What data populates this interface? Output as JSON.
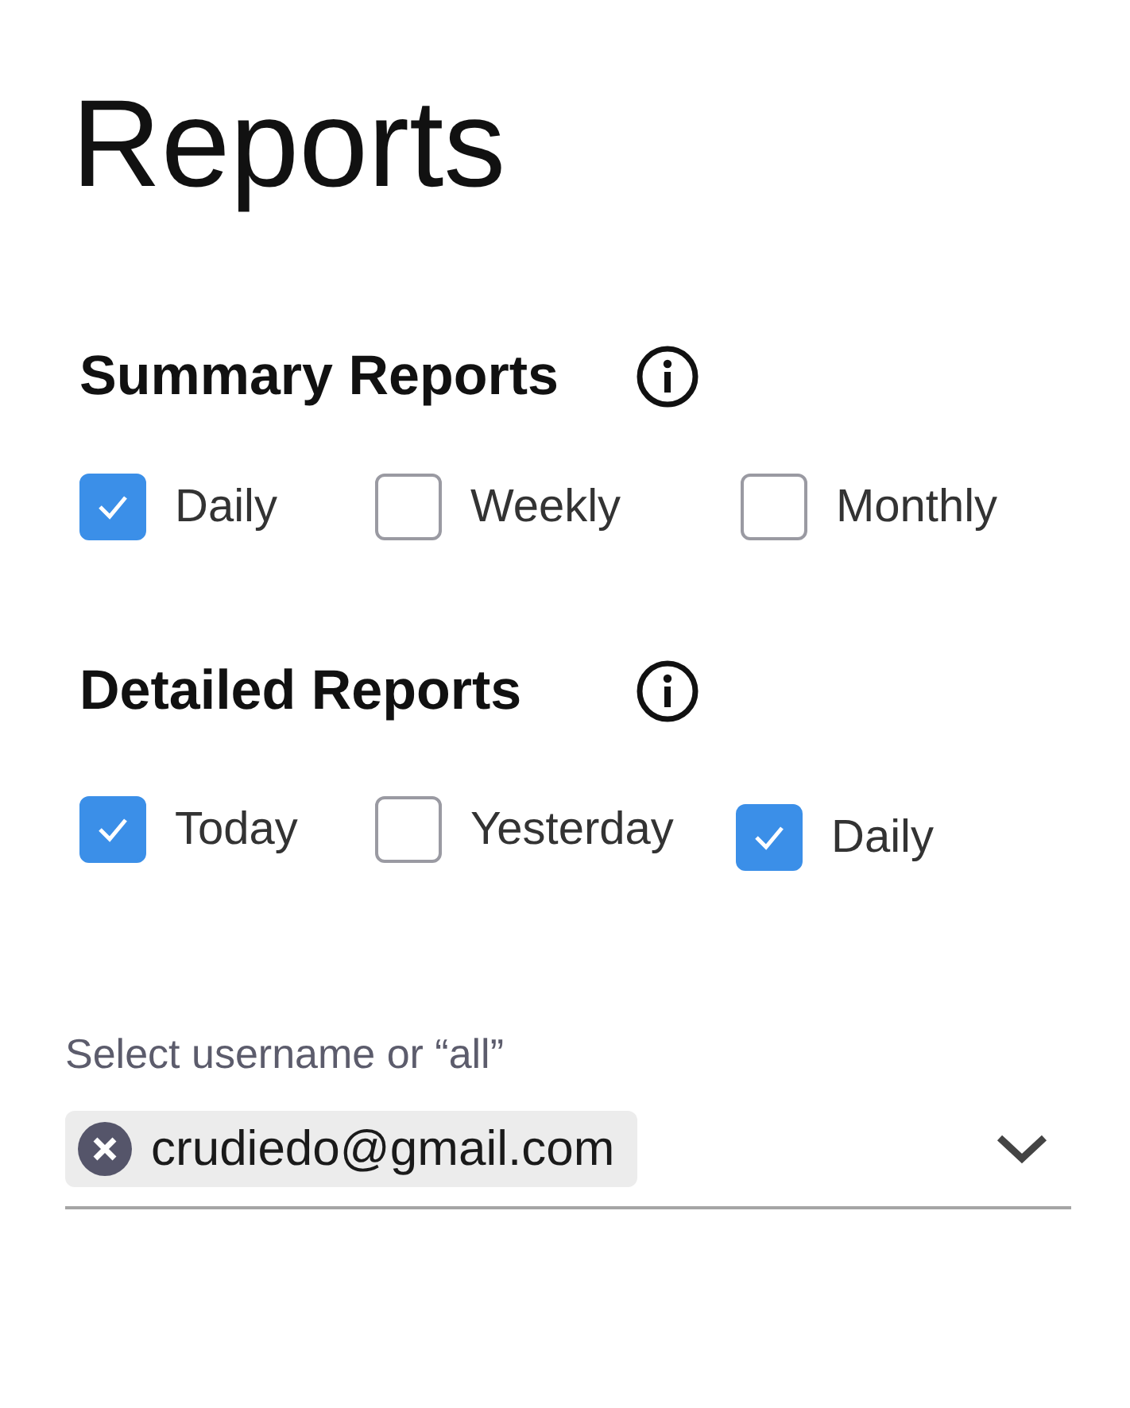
{
  "title": "Reports",
  "sections": [
    {
      "heading": "Summary Reports",
      "options": [
        {
          "label": "Daily",
          "checked": true
        },
        {
          "label": "Weekly",
          "checked": false
        },
        {
          "label": "Monthly",
          "checked": false
        }
      ]
    },
    {
      "heading": "Detailed Reports",
      "options": [
        {
          "label": "Today",
          "checked": true
        },
        {
          "label": "Yesterday",
          "checked": false
        },
        {
          "label": "Daily",
          "checked": true
        }
      ]
    }
  ],
  "user_select": {
    "label": "Select username or “all”",
    "chips": [
      {
        "text": "crudiedo@gmail.com"
      }
    ]
  }
}
